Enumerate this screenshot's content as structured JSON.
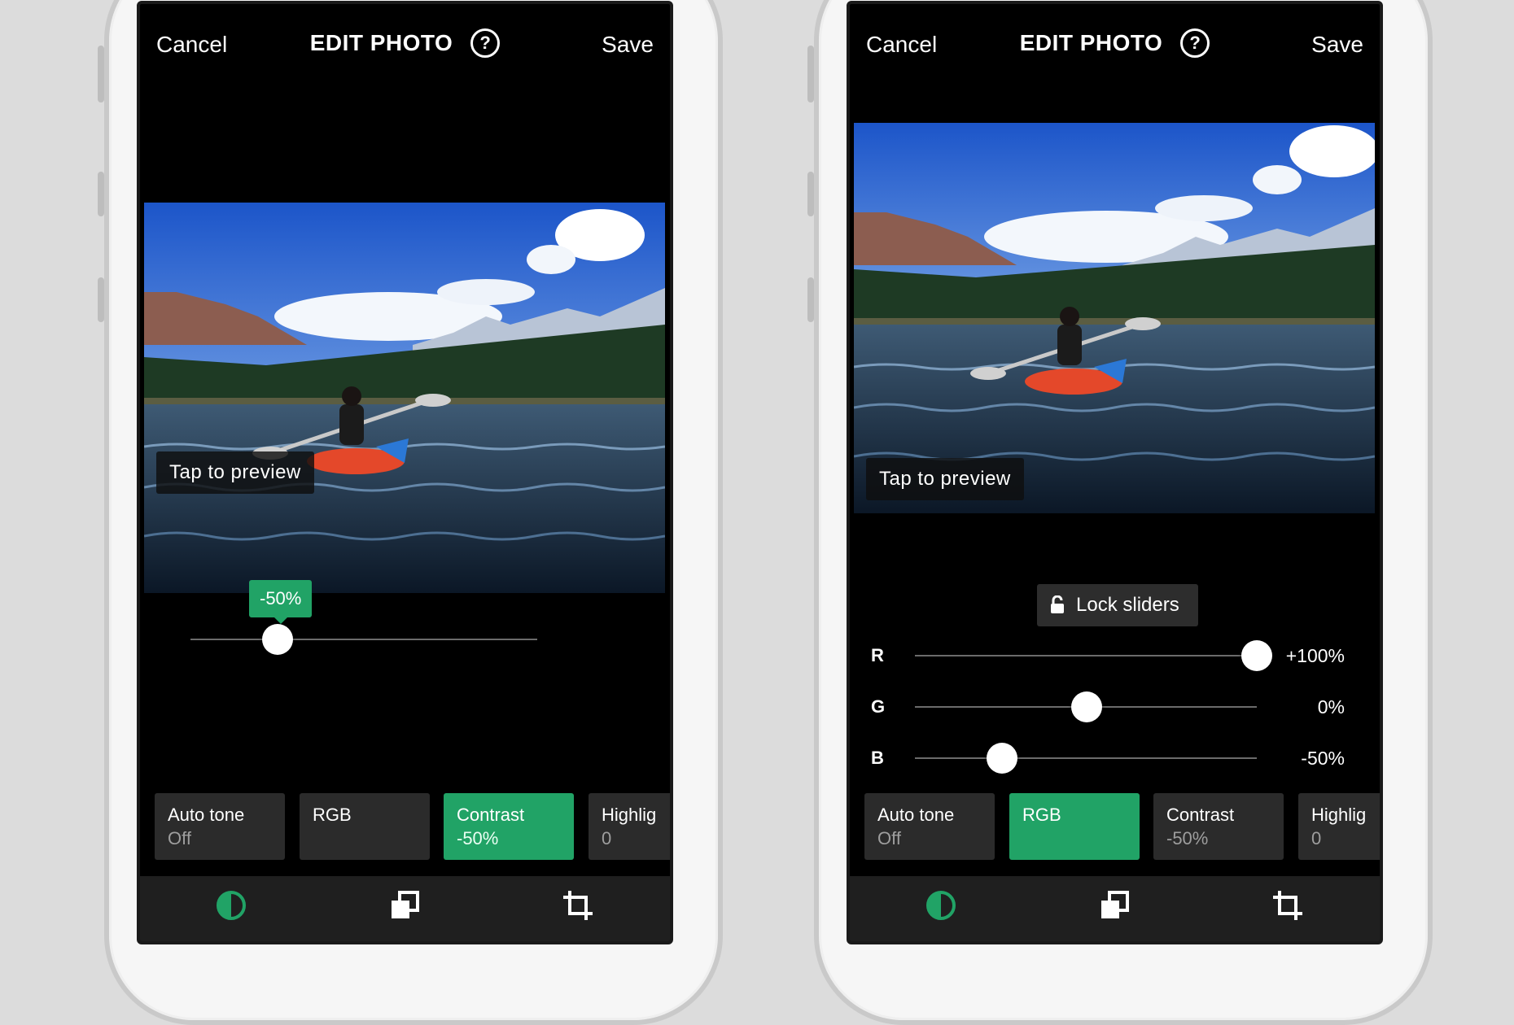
{
  "colors": {
    "accent": "#21a366",
    "chip_bg": "#2b2b2b",
    "bar_bg": "#1f1f1f"
  },
  "left_screen": {
    "topbar": {
      "cancel": "Cancel",
      "title": "EDIT PHOTO",
      "help": "?",
      "save": "Save"
    },
    "preview_label": "Tap to preview",
    "slider": {
      "tooltip": "-50%",
      "value_percent": -50
    },
    "chips": [
      {
        "label": "Auto tone",
        "sub": "Off"
      },
      {
        "label": "RGB",
        "sub": ""
      },
      {
        "label": "Contrast",
        "sub": "-50%"
      },
      {
        "label": "Highlig",
        "sub": "0"
      }
    ],
    "active_chip": "Contrast",
    "tabs": [
      "adjust-icon",
      "layers-icon",
      "crop-icon"
    ]
  },
  "right_screen": {
    "topbar": {
      "cancel": "Cancel",
      "title": "EDIT PHOTO",
      "help": "?",
      "save": "Save"
    },
    "preview_label": "Tap to preview",
    "lock_label": "Lock sliders",
    "rgb": [
      {
        "letter": "R",
        "value": "+100%",
        "percent": 100
      },
      {
        "letter": "G",
        "value": "0%",
        "percent": 0
      },
      {
        "letter": "B",
        "value": "-50%",
        "percent": -50
      }
    ],
    "chips": [
      {
        "label": "Auto tone",
        "sub": "Off"
      },
      {
        "label": "RGB",
        "sub": ""
      },
      {
        "label": "Contrast",
        "sub": "-50%"
      },
      {
        "label": "Highlig",
        "sub": "0"
      }
    ],
    "active_chip": "RGB",
    "tabs": [
      "adjust-icon",
      "layers-icon",
      "crop-icon"
    ]
  }
}
